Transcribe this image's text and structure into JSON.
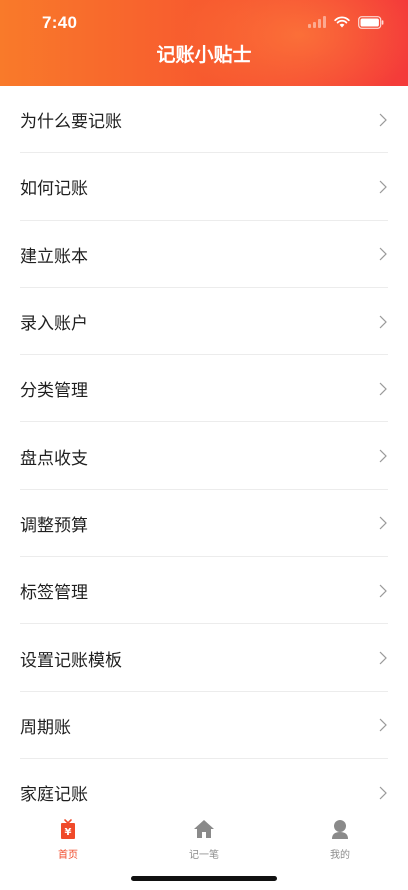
{
  "status_bar": {
    "time": "7:40"
  },
  "header": {
    "title": "记账小贴士"
  },
  "list": {
    "items": [
      {
        "label": "为什么要记账"
      },
      {
        "label": "如何记账"
      },
      {
        "label": "建立账本"
      },
      {
        "label": "录入账户"
      },
      {
        "label": "分类管理"
      },
      {
        "label": "盘点收支"
      },
      {
        "label": "调整预算"
      },
      {
        "label": "标签管理"
      },
      {
        "label": "设置记账模板"
      },
      {
        "label": "周期账"
      },
      {
        "label": "家庭记账"
      }
    ]
  },
  "tab_bar": {
    "tabs": [
      {
        "label": "首页",
        "icon": "ledger-icon",
        "active": true
      },
      {
        "label": "记一笔",
        "icon": "house-icon",
        "active": false
      },
      {
        "label": "我的",
        "icon": "person-icon",
        "active": false
      }
    ]
  },
  "colors": {
    "accent": "#f04a2a",
    "header_start": "#f97a2a",
    "header_end": "#f43a3a"
  }
}
